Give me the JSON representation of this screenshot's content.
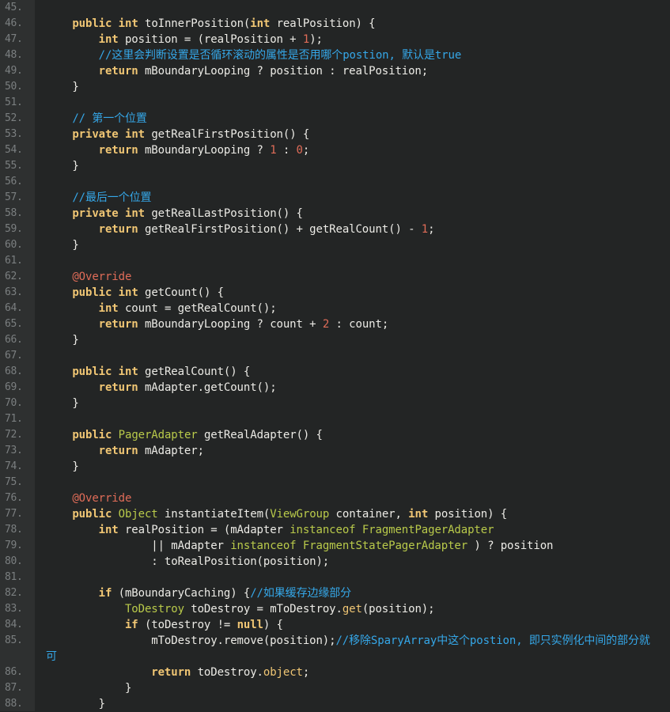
{
  "colors": {
    "background": "#232525",
    "gutter": "#2e3030",
    "line_number": "#7b7f80",
    "text": "#ecebe6",
    "keyword": "#f0c674",
    "type": "#b9ca4a",
    "number": "#e06c58",
    "comment": "#35a7e8",
    "annotation": "#e06c58"
  },
  "lines": [
    {
      "n": "45.",
      "segs": []
    },
    {
      "n": "46.",
      "segs": [
        [
          "",
          "    "
        ],
        [
          "k",
          "public"
        ],
        [
          "",
          " "
        ],
        [
          "k",
          "int"
        ],
        [
          "",
          " toInnerPosition("
        ],
        [
          "k",
          "int"
        ],
        [
          "",
          " realPosition) {"
        ]
      ]
    },
    {
      "n": "47.",
      "segs": [
        [
          "",
          "        "
        ],
        [
          "k",
          "int"
        ],
        [
          "",
          " position = (realPosition + "
        ],
        [
          "n",
          "1"
        ],
        [
          "",
          ");"
        ]
      ]
    },
    {
      "n": "48.",
      "segs": [
        [
          "",
          "        "
        ],
        [
          "c",
          "//这里会判断设置是否循环滚动的属性是否用哪个postion, 默认是true"
        ]
      ]
    },
    {
      "n": "49.",
      "segs": [
        [
          "",
          "        "
        ],
        [
          "k",
          "return"
        ],
        [
          "",
          " mBoundaryLooping ? position : realPosition;"
        ]
      ]
    },
    {
      "n": "50.",
      "segs": [
        [
          "",
          "    }"
        ]
      ]
    },
    {
      "n": "51.",
      "segs": []
    },
    {
      "n": "52.",
      "segs": [
        [
          "",
          "    "
        ],
        [
          "c",
          "// 第一个位置"
        ]
      ]
    },
    {
      "n": "53.",
      "segs": [
        [
          "",
          "    "
        ],
        [
          "k",
          "private"
        ],
        [
          "",
          " "
        ],
        [
          "k",
          "int"
        ],
        [
          "",
          " getRealFirstPosition() {"
        ]
      ]
    },
    {
      "n": "54.",
      "segs": [
        [
          "",
          "        "
        ],
        [
          "k",
          "return"
        ],
        [
          "",
          " mBoundaryLooping ? "
        ],
        [
          "n",
          "1"
        ],
        [
          "",
          " : "
        ],
        [
          "n",
          "0"
        ],
        [
          "",
          ";"
        ]
      ]
    },
    {
      "n": "55.",
      "segs": [
        [
          "",
          "    }"
        ]
      ]
    },
    {
      "n": "56.",
      "segs": []
    },
    {
      "n": "57.",
      "segs": [
        [
          "",
          "    "
        ],
        [
          "c",
          "//最后一个位置"
        ]
      ]
    },
    {
      "n": "58.",
      "segs": [
        [
          "",
          "    "
        ],
        [
          "k",
          "private"
        ],
        [
          "",
          " "
        ],
        [
          "k",
          "int"
        ],
        [
          "",
          " getRealLastPosition() {"
        ]
      ]
    },
    {
      "n": "59.",
      "segs": [
        [
          "",
          "        "
        ],
        [
          "k",
          "return"
        ],
        [
          "",
          " getRealFirstPosition() + getRealCount() - "
        ],
        [
          "n",
          "1"
        ],
        [
          "",
          ";"
        ]
      ]
    },
    {
      "n": "60.",
      "segs": [
        [
          "",
          "    }"
        ]
      ]
    },
    {
      "n": "61.",
      "segs": []
    },
    {
      "n": "62.",
      "segs": [
        [
          "",
          "    "
        ],
        [
          "a",
          "@Override"
        ]
      ]
    },
    {
      "n": "63.",
      "segs": [
        [
          "",
          "    "
        ],
        [
          "k",
          "public"
        ],
        [
          "",
          " "
        ],
        [
          "k",
          "int"
        ],
        [
          "",
          " getCount() {"
        ]
      ]
    },
    {
      "n": "64.",
      "segs": [
        [
          "",
          "        "
        ],
        [
          "k",
          "int"
        ],
        [
          "",
          " count = getRealCount();"
        ]
      ]
    },
    {
      "n": "65.",
      "segs": [
        [
          "",
          "        "
        ],
        [
          "k",
          "return"
        ],
        [
          "",
          " mBoundaryLooping ? count + "
        ],
        [
          "n",
          "2"
        ],
        [
          "",
          " : count;"
        ]
      ]
    },
    {
      "n": "66.",
      "segs": [
        [
          "",
          "    }"
        ]
      ]
    },
    {
      "n": "67.",
      "segs": []
    },
    {
      "n": "68.",
      "segs": [
        [
          "",
          "    "
        ],
        [
          "k",
          "public"
        ],
        [
          "",
          " "
        ],
        [
          "k",
          "int"
        ],
        [
          "",
          " getRealCount() {"
        ]
      ]
    },
    {
      "n": "69.",
      "segs": [
        [
          "",
          "        "
        ],
        [
          "k",
          "return"
        ],
        [
          "",
          " mAdapter.getCount();"
        ]
      ]
    },
    {
      "n": "70.",
      "segs": [
        [
          "",
          "    }"
        ]
      ]
    },
    {
      "n": "71.",
      "segs": []
    },
    {
      "n": "72.",
      "segs": [
        [
          "",
          "    "
        ],
        [
          "k",
          "public"
        ],
        [
          "",
          " "
        ],
        [
          "t",
          "PagerAdapter"
        ],
        [
          "",
          " getRealAdapter() {"
        ]
      ]
    },
    {
      "n": "73.",
      "segs": [
        [
          "",
          "        "
        ],
        [
          "k",
          "return"
        ],
        [
          "",
          " mAdapter;"
        ]
      ]
    },
    {
      "n": "74.",
      "segs": [
        [
          "",
          "    }"
        ]
      ]
    },
    {
      "n": "75.",
      "segs": []
    },
    {
      "n": "76.",
      "segs": [
        [
          "",
          "    "
        ],
        [
          "a",
          "@Override"
        ]
      ]
    },
    {
      "n": "77.",
      "segs": [
        [
          "",
          "    "
        ],
        [
          "k",
          "public"
        ],
        [
          "",
          " "
        ],
        [
          "t",
          "Object"
        ],
        [
          "",
          " instantiateItem("
        ],
        [
          "t",
          "ViewGroup"
        ],
        [
          "",
          " container, "
        ],
        [
          "k",
          "int"
        ],
        [
          "",
          " position) {"
        ]
      ]
    },
    {
      "n": "78.",
      "segs": [
        [
          "",
          "        "
        ],
        [
          "k",
          "int"
        ],
        [
          "",
          " realPosition = (mAdapter "
        ],
        [
          "t",
          "instanceof"
        ],
        [
          "",
          " "
        ],
        [
          "t",
          "FragmentPagerAdapter"
        ]
      ]
    },
    {
      "n": "79.",
      "segs": [
        [
          "",
          "                || mAdapter "
        ],
        [
          "t",
          "instanceof"
        ],
        [
          "",
          " "
        ],
        [
          "t",
          "FragmentStatePagerAdapter"
        ],
        [
          "",
          " ) ? position"
        ]
      ]
    },
    {
      "n": "80.",
      "segs": [
        [
          "",
          "                : toRealPosition(position);"
        ]
      ]
    },
    {
      "n": "81.",
      "segs": []
    },
    {
      "n": "82.",
      "segs": [
        [
          "",
          "        "
        ],
        [
          "k",
          "if"
        ],
        [
          "",
          " (mBoundaryCaching) {"
        ],
        [
          "c",
          "//如果缓存边缘部分"
        ]
      ]
    },
    {
      "n": "83.",
      "segs": [
        [
          "",
          "            "
        ],
        [
          "t",
          "ToDestroy"
        ],
        [
          "",
          " toDestroy = mToDestroy."
        ],
        [
          "m",
          "get"
        ],
        [
          "",
          "(position);"
        ]
      ]
    },
    {
      "n": "84.",
      "segs": [
        [
          "",
          "            "
        ],
        [
          "k",
          "if"
        ],
        [
          "",
          " (toDestroy != "
        ],
        [
          "k",
          "null"
        ],
        [
          "",
          ") {"
        ]
      ]
    },
    {
      "n": "85.",
      "segs": [
        [
          "",
          "                mToDestroy.remove(position);"
        ],
        [
          "c",
          "//移除SparyArray中这个postion, 即只实例化中间的部分就"
        ]
      ]
    },
    {
      "n": "",
      "segs": [
        [
          "c",
          "可"
        ]
      ],
      "wrap": true
    },
    {
      "n": "86.",
      "segs": [
        [
          "",
          "                "
        ],
        [
          "k",
          "return"
        ],
        [
          "",
          " toDestroy."
        ],
        [
          "m",
          "object"
        ],
        [
          "",
          ";"
        ]
      ]
    },
    {
      "n": "87.",
      "segs": [
        [
          "",
          "            }"
        ]
      ]
    },
    {
      "n": "88.",
      "segs": [
        [
          "",
          "        }"
        ]
      ]
    }
  ]
}
